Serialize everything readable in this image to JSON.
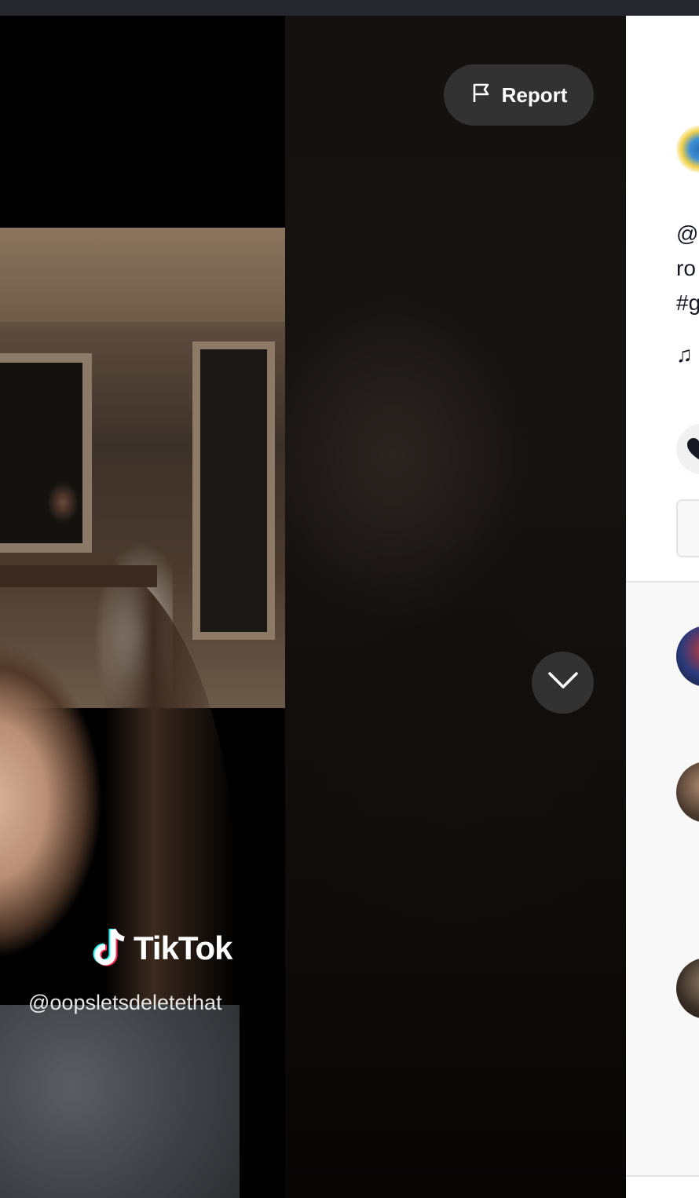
{
  "player": {
    "report_label": "Report",
    "watermark_brand": "TikTok",
    "watermark_handle": "@oopsletsdeletethat",
    "icons": {
      "report": "flag-icon",
      "next": "chevron-down-icon",
      "brand": "tiktok-note-icon"
    }
  },
  "side_panel": {
    "description_lines": [
      "@a",
      "ro",
      "#g"
    ],
    "music_prefix": "♫",
    "colors": {
      "panel_bg": "#ffffff",
      "comments_bg": "#f8f8f8",
      "text": "#161823"
    }
  },
  "colors": {
    "button_bg": "#323232",
    "stage_bg": "#0a0806",
    "top_bar": "#24272c"
  }
}
